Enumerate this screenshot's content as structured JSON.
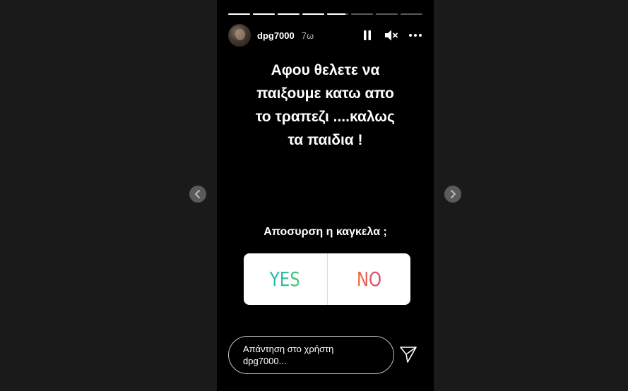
{
  "story": {
    "progress": {
      "segments": 8,
      "completed": 4,
      "current_fraction": 0.85
    },
    "user": {
      "username": "dpg7000",
      "time_ago": "7ω"
    },
    "icons": {
      "pause": "pause-icon",
      "mute": "mute-icon",
      "more": "more-icon"
    },
    "caption_lines": [
      "Αφου θελετε να",
      "παιξουμε κατω απο",
      "το τραπεζι ....καλως",
      "τα παιδια !"
    ],
    "poll": {
      "question": "Αποσυρση η καγκελα ;",
      "options": [
        {
          "label": "YES",
          "gradient": [
            "#13b6c3",
            "#52c96b"
          ]
        },
        {
          "label": "NO",
          "gradient": [
            "#ee6a3a",
            "#e0427a"
          ]
        }
      ]
    },
    "reply": {
      "placeholder_line1": "Απάντηση στο χρήστη",
      "placeholder_line2": "dpg7000..."
    }
  },
  "nav": {
    "prev_icon": "chevron-left-icon",
    "next_icon": "chevron-right-icon"
  }
}
